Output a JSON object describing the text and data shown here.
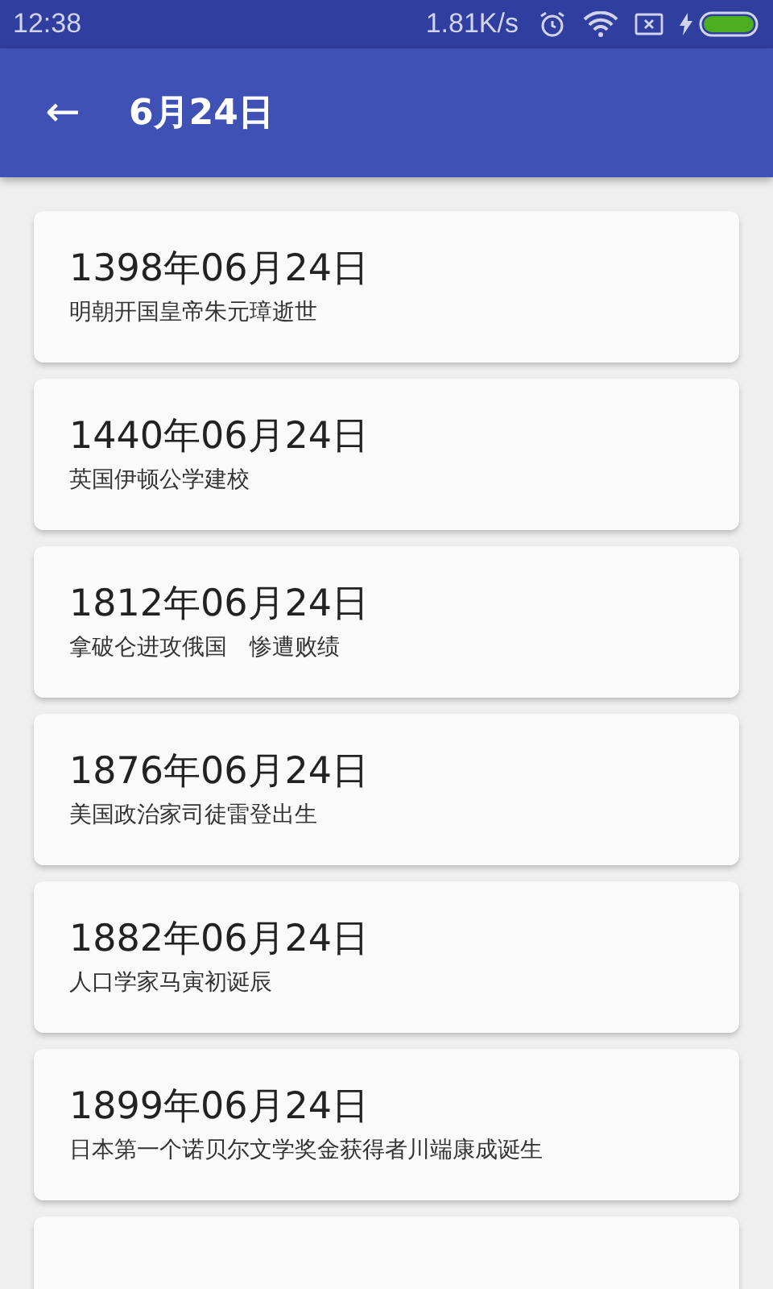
{
  "status_bar": {
    "time": "12:38",
    "speed": "1.81K/s"
  },
  "app_bar": {
    "back": "←",
    "title": "6月24日"
  },
  "events": [
    {
      "date": "1398年06月24日",
      "text": "明朝开国皇帝朱元璋逝世"
    },
    {
      "date": "1440年06月24日",
      "text": "英国伊顿公学建校"
    },
    {
      "date": "1812年06月24日",
      "text": "拿破仑进攻俄国　惨遭败绩"
    },
    {
      "date": "1876年06月24日",
      "text": "美国政治家司徒雷登出生"
    },
    {
      "date": "1882年06月24日",
      "text": "人口学家马寅初诞辰"
    },
    {
      "date": "1899年06月24日",
      "text": "日本第一个诺贝尔文学奖金获得者川端康成诞生"
    }
  ],
  "more_card_below": true
}
